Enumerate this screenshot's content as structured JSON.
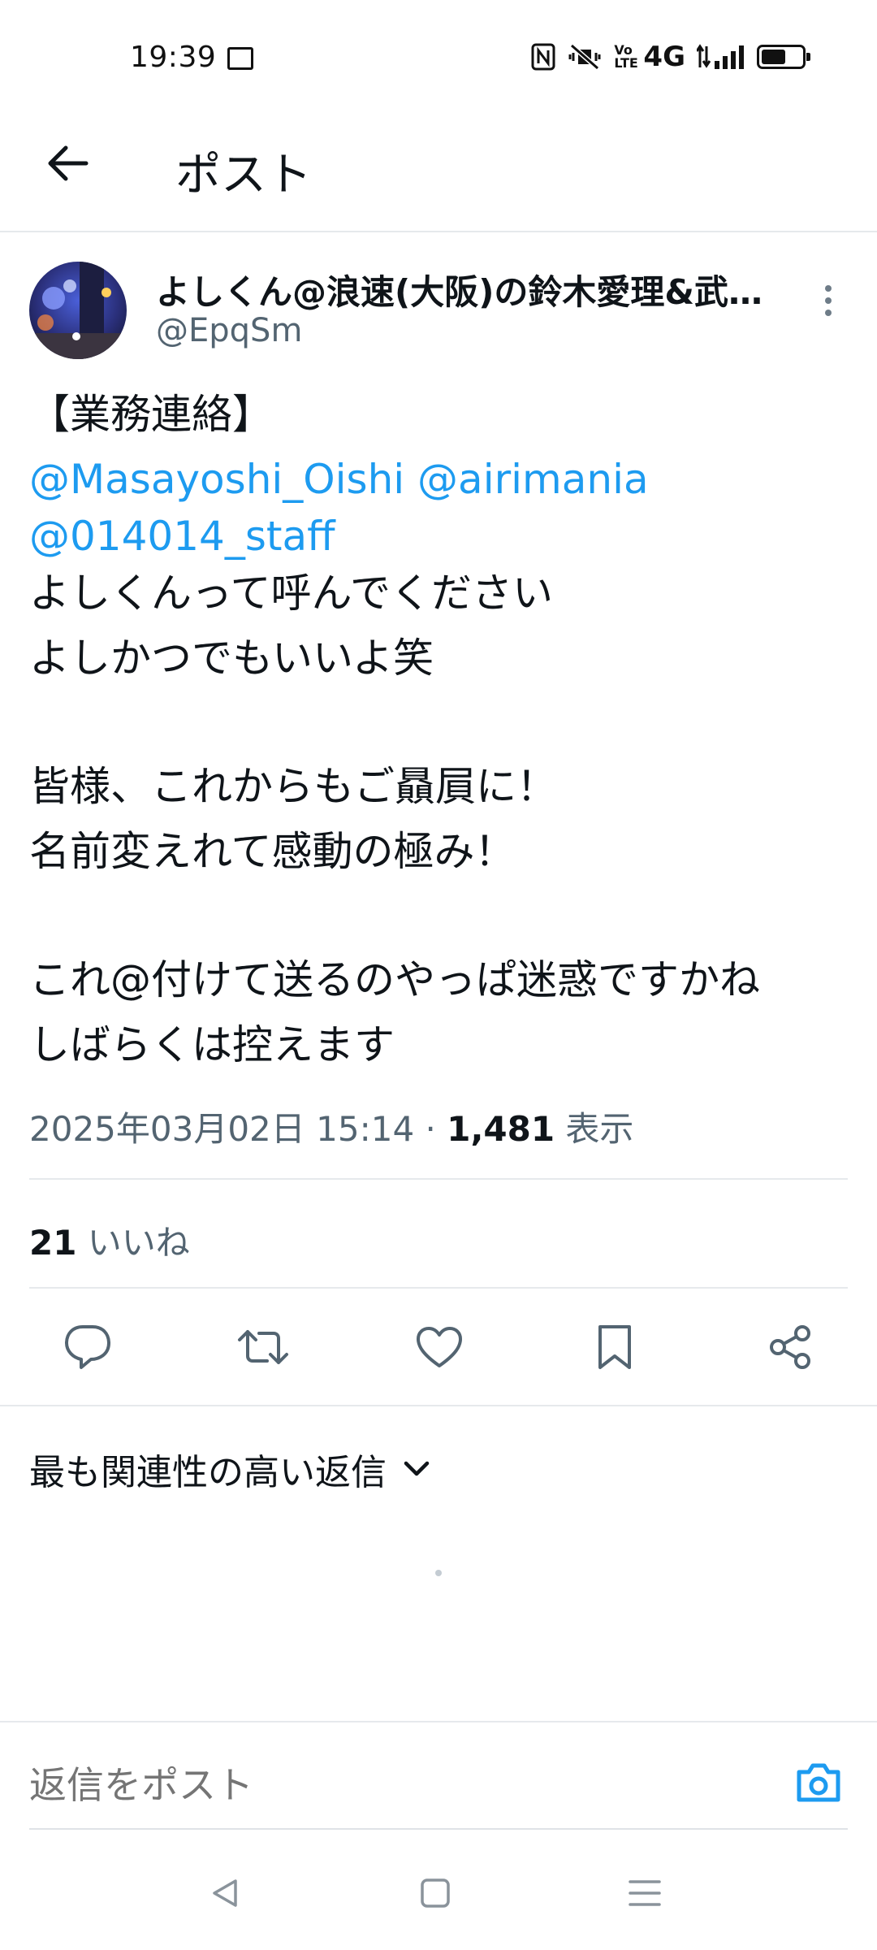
{
  "status_bar": {
    "time": "19:39",
    "volte_label": "Vo\nLTE",
    "network": "4G",
    "battery_level": 0.6
  },
  "header": {
    "title": "ポスト"
  },
  "author": {
    "name": "よしくん@浪速(大阪)の鈴木愛理&武…",
    "handle": "@EpqSm"
  },
  "tweet": {
    "lines": [
      "【業務連絡】",
      "@Masayoshi_Oishi @airimania",
      "@014014_staff",
      "よしくんって呼んでください",
      "よしかつでもいいよ笑",
      "皆様、これからもご贔屓に！",
      "名前変えれて感動の極み！",
      "これ@付けて送るのやっぱ迷惑ですかね",
      "しばらくは控えます"
    ],
    "timestamp": "2025年03月02日 15:14 · ",
    "views_count": "1,481",
    "views_label": " 表示"
  },
  "stats": {
    "likes_count": "21",
    "likes_label": " いいね"
  },
  "actions": {
    "icons": [
      "reply-icon",
      "retweet-icon",
      "like-icon",
      "bookmark-icon",
      "share-icon"
    ]
  },
  "replies": {
    "sort_label": "最も関連性の高い返信"
  },
  "composer": {
    "placeholder": "返信をポスト"
  },
  "colors": {
    "accent": "#1d9bf0",
    "text_primary": "#0f1419",
    "text_secondary": "#536471",
    "divider": "#e6e9ec"
  }
}
